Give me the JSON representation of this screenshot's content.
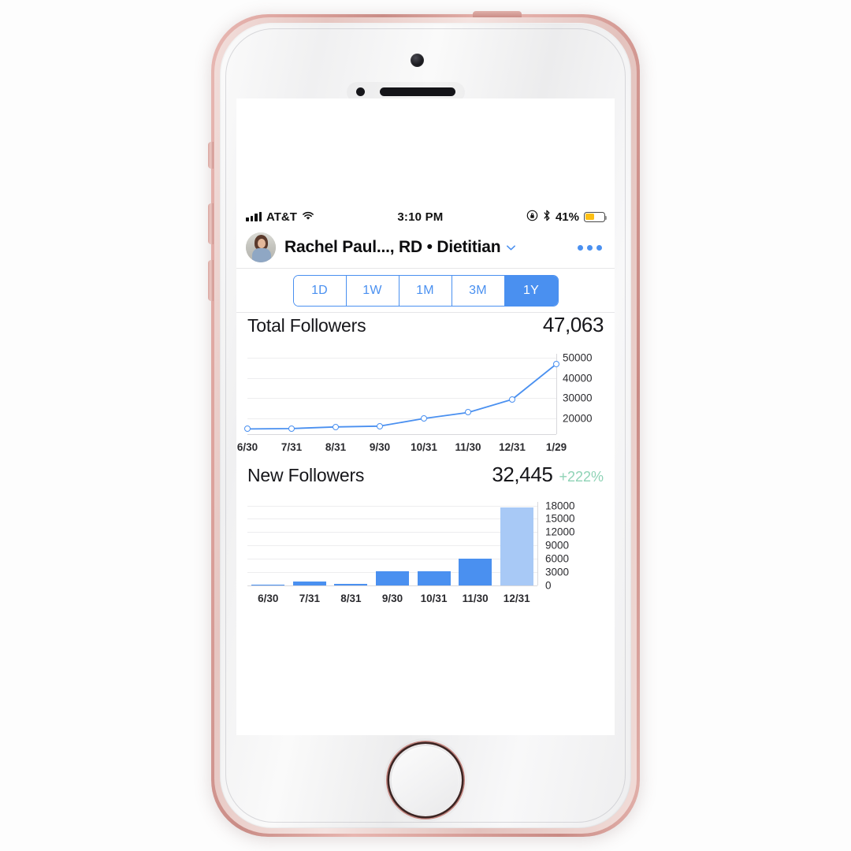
{
  "device": {
    "name": "iPhone SE rose gold",
    "buttons": [
      "mute-switch",
      "volume-up",
      "volume-down",
      "power"
    ]
  },
  "status_bar": {
    "signal_icon": "signal-bars-icon",
    "carrier": "AT&T",
    "wifi_icon": "wifi-icon",
    "time": "3:10 PM",
    "rotation_lock_icon": "rotation-lock-icon",
    "bluetooth_icon": "bluetooth-icon",
    "battery_percent": "41%",
    "battery_icon": "battery-low-power-icon",
    "battery_fill_color": "#fcbf14"
  },
  "header": {
    "avatar": "profile-avatar",
    "title": "Rachel Paul..., RD • Dietitian",
    "chevron_icon": "chevron-down-icon",
    "more_icon": "more-options-icon"
  },
  "range_selector": {
    "options": [
      "1D",
      "1W",
      "1M",
      "3M",
      "1Y"
    ],
    "selected": "1Y",
    "accent_color": "#4a90f0"
  },
  "sections": [
    {
      "title": "Total Followers",
      "value": "47,063",
      "delta": ""
    },
    {
      "title": "New Followers",
      "value": "32,445",
      "delta": "+222%",
      "delta_color": "#8fd3b6"
    }
  ],
  "chart_data": [
    {
      "type": "line",
      "title": "Total Followers",
      "xlabel": "",
      "ylabel": "",
      "categories": [
        "6/30",
        "7/31",
        "8/31",
        "9/30",
        "10/31",
        "11/30",
        "12/31",
        "1/29"
      ],
      "values": [
        14600,
        14800,
        15600,
        16000,
        19800,
        22800,
        29300,
        46900
      ],
      "yticks": [
        20000,
        30000,
        40000,
        50000
      ],
      "ylim": [
        12000,
        52000
      ],
      "grid": true,
      "legend": "none",
      "line_color": "#4a90f0",
      "marker": "open-circle"
    },
    {
      "type": "bar",
      "title": "New Followers",
      "xlabel": "",
      "ylabel": "",
      "categories": [
        "6/30",
        "7/31",
        "8/31",
        "9/30",
        "10/31",
        "11/30",
        "12/31"
      ],
      "values": [
        250,
        900,
        400,
        3200,
        3200,
        6000,
        17500
      ],
      "yticks": [
        0,
        3000,
        6000,
        9000,
        12000,
        15000,
        18000
      ],
      "ylim": [
        0,
        18800
      ],
      "grid": true,
      "legend": "none",
      "bar_color": "#4a90f0",
      "partial_bar_color": "#a8c9f6",
      "partial_index": 6
    }
  ]
}
